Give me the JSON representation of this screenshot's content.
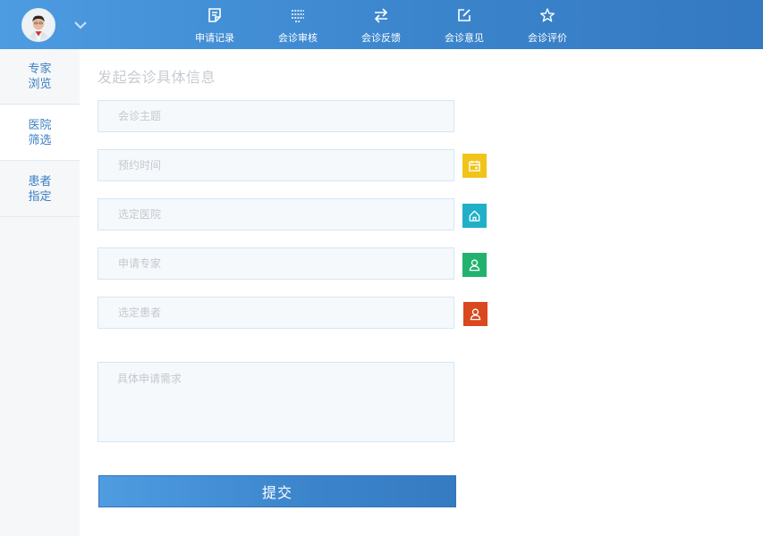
{
  "header": {
    "nav": [
      {
        "label": "申请记录",
        "icon": "edit-document-icon"
      },
      {
        "label": "会诊审核",
        "icon": "list-icon"
      },
      {
        "label": "会诊反馈",
        "icon": "swap-arrows-icon"
      },
      {
        "label": "会诊意见",
        "icon": "edit-square-icon"
      },
      {
        "label": "会诊评价",
        "icon": "star-icon"
      }
    ]
  },
  "sidebar": {
    "items": [
      {
        "label": "专家浏览"
      },
      {
        "label": "医院筛选"
      },
      {
        "label": "患者指定"
      }
    ]
  },
  "main": {
    "title": "发起会诊具体信息",
    "fields": {
      "topic": {
        "placeholder": "会诊主题",
        "value": ""
      },
      "time": {
        "placeholder": "预约时间",
        "value": ""
      },
      "hospital": {
        "placeholder": "选定医院",
        "value": ""
      },
      "expert": {
        "placeholder": "申请专家",
        "value": ""
      },
      "patient": {
        "placeholder": "选定患者",
        "value": ""
      },
      "requirements": {
        "placeholder": "具体申请需求",
        "value": ""
      }
    },
    "submit_label": "提交"
  },
  "colors": {
    "header_start": "#4d9be0",
    "header_end": "#3479c1",
    "calendar_button": "#f0c419",
    "hospital_button": "#1fb0c8",
    "expert_button": "#22b26e",
    "patient_button": "#d9481e",
    "sidebar_text": "#3a7fc2"
  }
}
